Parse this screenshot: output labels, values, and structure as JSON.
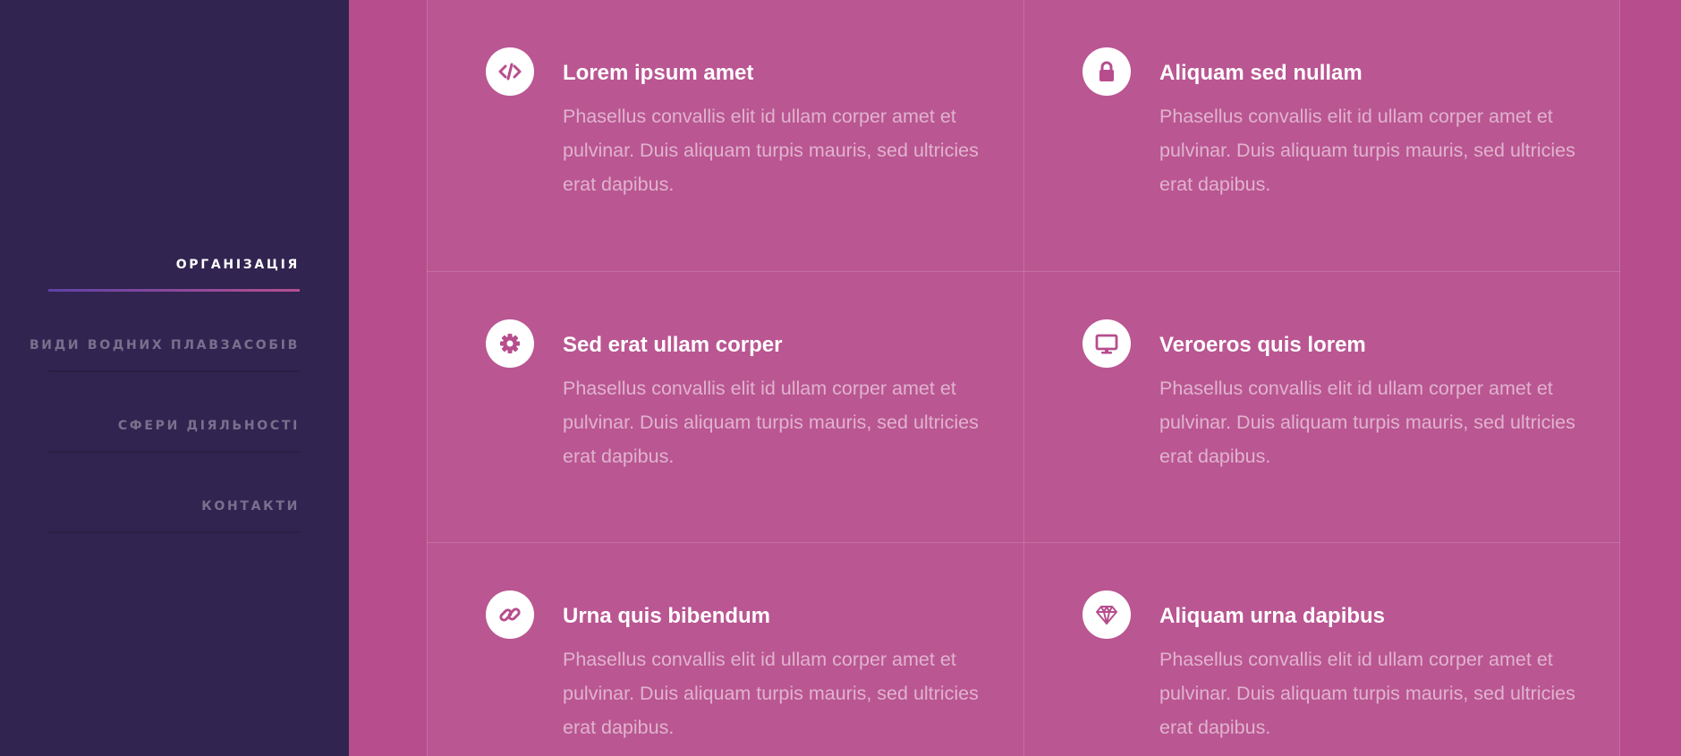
{
  "nav": {
    "items": [
      {
        "label": "ОРГАНІЗАЦІЯ",
        "active": true
      },
      {
        "label": "ВИДИ ВОДНИХ ПЛАВЗАСОБІВ",
        "active": false
      },
      {
        "label": "СФЕРИ ДІЯЛЬНОСТІ",
        "active": false
      },
      {
        "label": "КОНТАКТИ",
        "active": false
      }
    ]
  },
  "features": [
    {
      "icon": "code-icon",
      "title": "Lorem ipsum amet",
      "text": "Phasellus convallis elit id ullam corper amet et pulvinar. Duis aliquam turpis mauris, sed ultricies erat dapibus."
    },
    {
      "icon": "lock-icon",
      "title": "Aliquam sed nullam",
      "text": "Phasellus convallis elit id ullam corper amet et pulvinar. Duis aliquam turpis mauris, sed ultricies erat dapibus."
    },
    {
      "icon": "gear-icon",
      "title": "Sed erat ullam corper",
      "text": "Phasellus convallis elit id ullam corper amet et pulvinar. Duis aliquam turpis mauris, sed ultricies erat dapibus."
    },
    {
      "icon": "desktop-icon",
      "title": "Veroeros quis lorem",
      "text": "Phasellus convallis elit id ullam corper amet et pulvinar. Duis aliquam turpis mauris, sed ultricies erat dapibus."
    },
    {
      "icon": "link-icon",
      "title": "Urna quis bibendum",
      "text": "Phasellus convallis elit id ullam corper amet et pulvinar. Duis aliquam turpis mauris, sed ultricies erat dapibus."
    },
    {
      "icon": "diamond-icon",
      "title": "Aliquam urna dapibus",
      "text": "Phasellus convallis elit id ullam corper amet et pulvinar. Duis aliquam turpis mauris, sed ultricies erat dapibus."
    }
  ],
  "colors": {
    "sidebar_bg": "#312450",
    "page_bg": "#b74d8d",
    "icon_color": "#b74d8d",
    "nav_active_gradient": [
      "#5e42a6",
      "#b74e91"
    ]
  }
}
